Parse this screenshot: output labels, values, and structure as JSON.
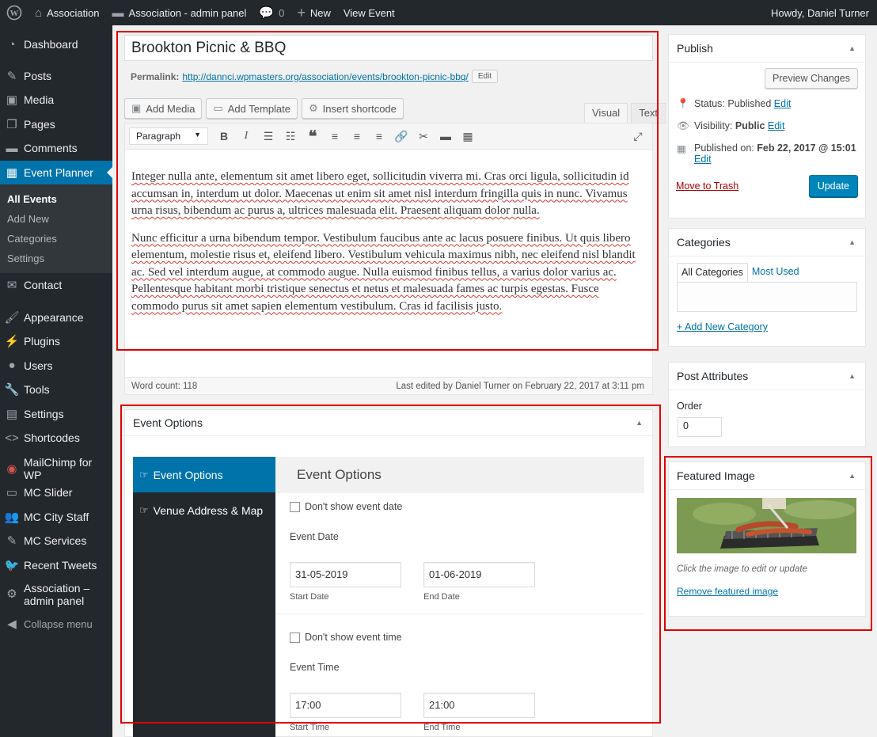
{
  "adminbar": {
    "site_name": "Association",
    "admin_panel": "Association - admin panel",
    "comments_count": "0",
    "new_label": "New",
    "view_label": "View Event",
    "howdy": "Howdy, Daniel Turner"
  },
  "sidebar": {
    "items": [
      {
        "label": "Dashboard",
        "icon": "dashboard-icon"
      },
      {
        "label": "Posts",
        "icon": "pin-icon"
      },
      {
        "label": "Media",
        "icon": "media-icon"
      },
      {
        "label": "Pages",
        "icon": "pages-icon"
      },
      {
        "label": "Comments",
        "icon": "comment-icon"
      },
      {
        "label": "Event Planner",
        "icon": "calendar-icon"
      }
    ],
    "submenu": [
      "All Events",
      "Add New",
      "Categories",
      "Settings"
    ],
    "items2": [
      {
        "label": "Contact",
        "icon": "mail-icon"
      },
      {
        "label": "Appearance",
        "icon": "brush-icon"
      },
      {
        "label": "Plugins",
        "icon": "plugin-icon"
      },
      {
        "label": "Users",
        "icon": "user-icon"
      },
      {
        "label": "Tools",
        "icon": "wrench-icon"
      },
      {
        "label": "Settings",
        "icon": "settings-icon"
      },
      {
        "label": "Shortcodes",
        "icon": "code-icon"
      },
      {
        "label": "MailChimp for WP",
        "icon": "mailchimp-icon"
      },
      {
        "label": "MC Slider",
        "icon": "slider-icon"
      },
      {
        "label": "MC City Staff",
        "icon": "staff-icon"
      },
      {
        "label": "MC Services",
        "icon": "services-icon"
      },
      {
        "label": "Recent Tweets",
        "icon": "twitter-icon"
      }
    ],
    "assoc_panel": "Association – admin panel",
    "collapse": "Collapse menu"
  },
  "post": {
    "title": "Brookton Picnic & BBQ",
    "permalink_label": "Permalink:",
    "permalink_url": "http://dannci.wpmasters.org/association/events/brookton-picnic-bbq/",
    "edit_label": "Edit"
  },
  "editor": {
    "add_media": "Add Media",
    "add_template": "Add Template",
    "insert_shortcode": "Insert shortcode",
    "tab_visual": "Visual",
    "tab_text": "Text",
    "format": "Paragraph",
    "paragraphs": [
      "Integer nulla ante, elementum sit amet libero eget, sollicitudin viverra mi. Cras orci ligula, sollicitudin id accumsan in, interdum ut dolor. Maecenas ut enim sit amet nisl interdum fringilla quis in nunc. Vivamus urna risus, bibendum ac purus a, ultrices malesuada elit. Praesent aliquam dolor nulla.",
      "Nunc efficitur a urna bibendum tempor. Vestibulum faucibus ante ac lacus posuere finibus. Ut quis libero elementum, molestie risus et, eleifend libero. Vestibulum vehicula maximus nibh, nec eleifend nisl blandit ac. Sed vel interdum augue, at commodo augue. Nulla euismod finibus tellus, a varius dolor varius ac. Pellentesque habitant morbi tristique senectus et netus et malesuada fames ac turpis egestas. Fusce commodo purus sit amet sapien elementum vestibulum. Cras id facilisis justo."
    ],
    "word_count": "Word count: 118",
    "last_edited": "Last edited by Daniel Turner on February 22, 2017 at 3:11 pm"
  },
  "event_options": {
    "box_title": "Event Options",
    "tab_event_options": "Event Options",
    "tab_venue": "Venue Address & Map",
    "section_title": "Event Options",
    "dont_show_date": "Don't show event date",
    "event_date_label": "Event Date",
    "start_date": "31-05-2019",
    "start_date_label": "Start Date",
    "end_date": "01-06-2019",
    "end_date_label": "End Date",
    "dont_show_time": "Don't show event time",
    "event_time_label": "Event Time",
    "start_time": "17:00",
    "start_time_label": "Start Time",
    "end_time": "21:00",
    "end_time_label": "End Time"
  },
  "publish": {
    "title": "Publish",
    "preview": "Preview Changes",
    "status_label": "Status:",
    "status_value": "Published",
    "visibility_label": "Visibility:",
    "visibility_value": "Public",
    "published_on_label": "Published on:",
    "published_on_value": "Feb 22, 2017 @ 15:01",
    "edit": "Edit",
    "trash": "Move to Trash",
    "update": "Update"
  },
  "categories": {
    "title": "Categories",
    "tab_all": "All Categories",
    "tab_most_used": "Most Used",
    "add_new": "+ Add New Category"
  },
  "attributes": {
    "title": "Post Attributes",
    "order_label": "Order",
    "order_value": "0"
  },
  "featured": {
    "title": "Featured Image",
    "hint": "Click the image to edit or update",
    "remove": "Remove featured image"
  },
  "colors": {
    "accent": "#0073aa",
    "admin_dark": "#23282d",
    "highlight_frame": "#e10000"
  }
}
